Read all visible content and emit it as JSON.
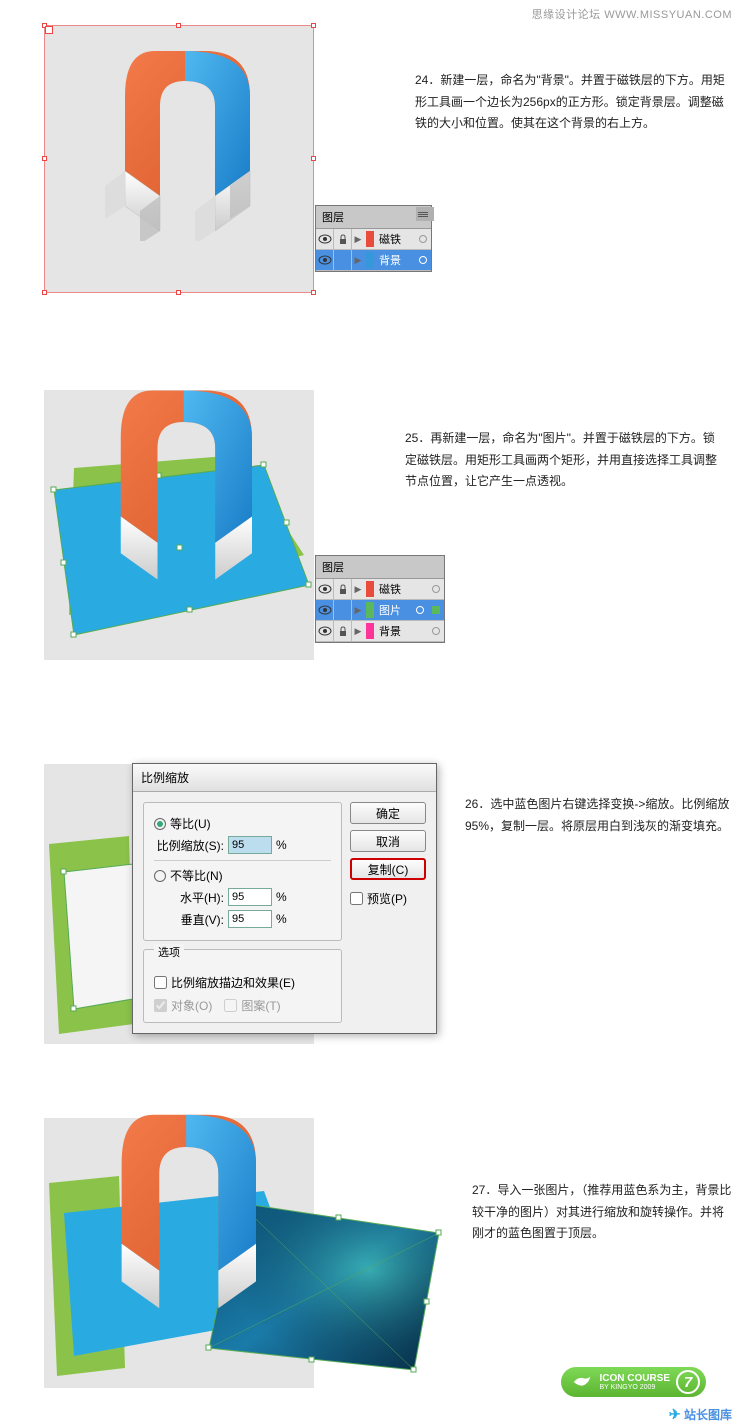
{
  "header": {
    "text": "思缘设计论坛  WWW.MISSYUAN.COM"
  },
  "step24": {
    "text": "24．新建一层，命名为\"背景\"。并置于磁铁层的下方。用矩形工具画一个边长为256px的正方形。锁定背景层。调整磁铁的大小和位置。使其在这个背景的右上方。"
  },
  "step25": {
    "text": "25．再新建一层，命名为\"图片\"。并置于磁铁层的下方。锁定磁铁层。用矩形工具画两个矩形，并用直接选择工具调整节点位置，让它产生一点透视。"
  },
  "step26": {
    "text": "26．选中蓝色图片右键选择变换->缩放。比例缩放95%，复制一层。将原层用白到浅灰的渐变填充。"
  },
  "step27": {
    "text": "27．导入一张图片，（推荐用蓝色系为主，背景比较干净的图片）对其进行缩放和旋转操作。并将刚才的蓝色图置于顶层。"
  },
  "layersPanel": {
    "title": "图层",
    "layer_magnet": "磁铁",
    "layer_bg": "背景",
    "layer_pic": "图片"
  },
  "dialog": {
    "title": "比例缩放",
    "uniform": "等比(U)",
    "scale_label": "比例缩放(S):",
    "scale_value": "95",
    "nonuniform": "不等比(N)",
    "horiz_label": "水平(H):",
    "horiz_value": "95",
    "vert_label": "垂直(V):",
    "vert_value": "95",
    "percent": "%",
    "options": "选项",
    "scale_strokes": "比例缩放描边和效果(E)",
    "objects": "对象(O)",
    "patterns": "图案(T)",
    "ok": "确定",
    "cancel": "取消",
    "copy": "复制(C)",
    "preview": "预览(P)"
  },
  "badge": {
    "line1": "ICON COURSE",
    "line2": "BY KINGYO 2009",
    "num": "7"
  },
  "footer": {
    "text": "站长图库"
  }
}
